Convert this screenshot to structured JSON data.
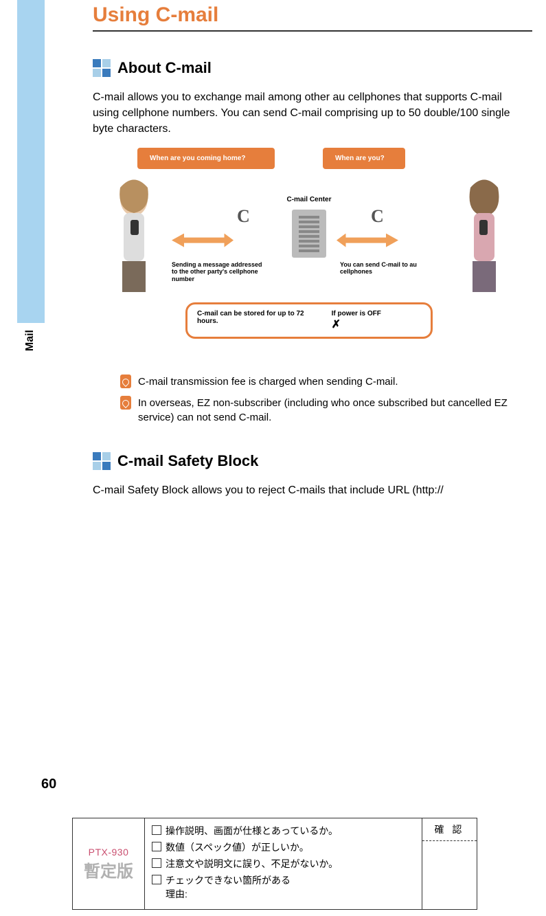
{
  "side_label": "Mail",
  "page_number": "60",
  "title": "Using C-mail",
  "section_about": {
    "heading": "About C-mail",
    "body": "C-mail allows you to exchange mail among other au cellphones that supports C-mail using cellphone numbers. You can send C-mail comprising up to 50 double/100 single byte characters."
  },
  "diagram": {
    "bubble_left": "When are you coming home?",
    "bubble_right": "When are you?",
    "center_label": "C-mail Center",
    "note_left": "Sending a message addressed to the other party's cellphone number",
    "note_right": "You can send C-mail to au cellphones",
    "info_left": "C-mail can be stored for up to 72 hours.",
    "info_right": "If power is OFF",
    "info_x": "✗"
  },
  "notes": [
    "C-mail transmission fee is charged when sending C-mail.",
    "In overseas, EZ non-subscriber (including who once subscribed but cancelled EZ service) can not send C-mail."
  ],
  "section_safety": {
    "heading": "C-mail Safety Block",
    "body": "C-mail Safety Block allows you to reject C-mails that include URL (http://"
  },
  "review": {
    "model": "PTX-930",
    "provisional": "暫定版",
    "checks": [
      "操作説明、画面が仕様とあっているか。",
      "数値（スペック値）が正しいか。",
      "注意文や説明文に誤り、不足がないか。",
      "チェックできない箇所がある\n理由:"
    ],
    "confirm": "確 認"
  }
}
